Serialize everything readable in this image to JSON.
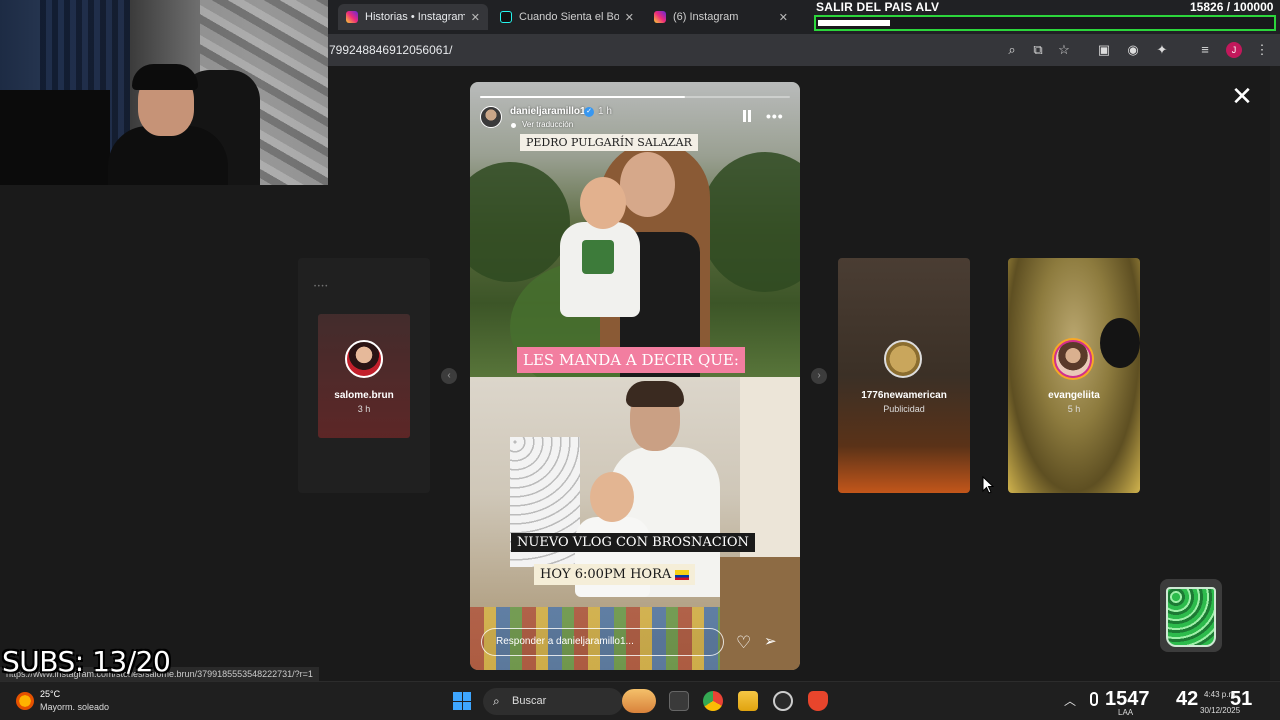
{
  "browser": {
    "tabs": [
      {
        "label": "Historias • Instagram",
        "icon": "instagram-icon",
        "active": true
      },
      {
        "label": "Cuando Sienta el Boom",
        "icon": "tiktok-icon",
        "active": false
      },
      {
        "label": "(6) Instagram",
        "icon": "instagram-icon",
        "active": false
      }
    ],
    "url": "799248846912056061/"
  },
  "overlay": {
    "goal_title": "SALIR DEL PAIS ALV",
    "goal_count": "15826  / 100000",
    "goal_progress": 0.158,
    "subs": "SUBS: 13/20"
  },
  "story": {
    "username": "danieljaramillo1",
    "time": "1 h",
    "translate": "Ver traducción",
    "progress": 0.66,
    "caption_top": "PEDRO PULGARÍN SALAZAR",
    "caption_mid": "LES MANDA A DECIR QUE:",
    "caption_vlog": "NUEVO VLOG CON BROSNACION",
    "caption_time": "HOY 6:00PM HORA",
    "reply_placeholder": "Responder a danieljaramillo1..."
  },
  "cards": {
    "prev": {
      "name": "salome.brun",
      "sub": "3 h"
    },
    "next1": {
      "name": "1776newamerican",
      "sub": "Publicidad"
    },
    "next2": {
      "name": "evangeliita",
      "sub": "5 h"
    }
  },
  "status_url": "https://www.instagram.com/stories/salome.brun/3799185553548222731/?r=1",
  "taskbar": {
    "weather_temp": "25°C",
    "weather_desc": "Mayorm. soleado",
    "search_label": "Buscar",
    "tray_left": "1547",
    "tray_mid": "42",
    "tray_right": "51",
    "clock": "4:43 p.m.",
    "date": "30/12/2025",
    "lang": "LAA"
  },
  "colors": {
    "goal_border": "#2cd63c",
    "caption_pink": "#f27ea0",
    "verified": "#3897f0"
  }
}
